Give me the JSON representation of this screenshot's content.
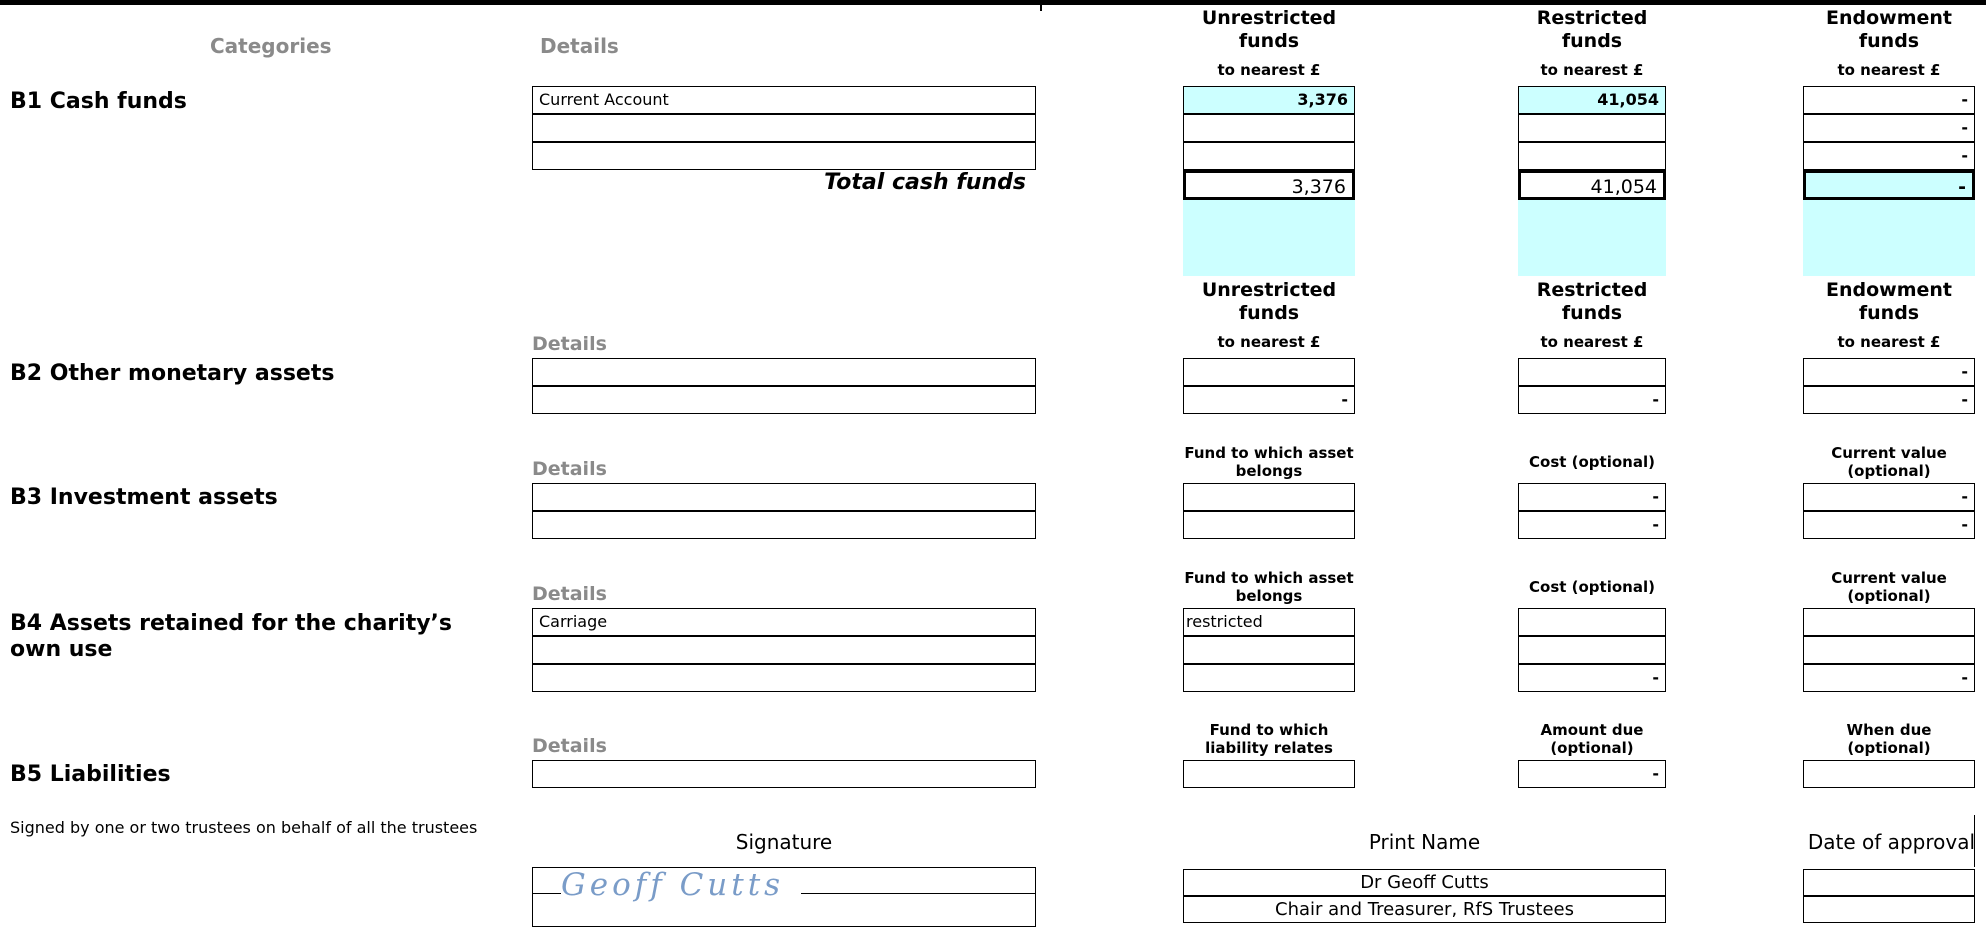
{
  "header": {
    "categories": "Categories",
    "details": "Details",
    "col_unrestricted": "Unrestricted funds",
    "col_restricted": "Restricted funds",
    "col_endowment": "Endowment funds",
    "nearest": "to nearest £"
  },
  "b1": {
    "title": "B1 Cash funds",
    "rows": [
      {
        "detail": "Current Account",
        "unrestricted": "3,376",
        "restricted": "41,054",
        "endowment": "-"
      },
      {
        "detail": "",
        "unrestricted": "",
        "restricted": "",
        "endowment": "-"
      },
      {
        "detail": "",
        "unrestricted": "",
        "restricted": "",
        "endowment": "-"
      }
    ],
    "total_label": "Total cash funds",
    "total_unrestricted": "3,376",
    "total_restricted": "41,054",
    "total_endowment": "-"
  },
  "b2": {
    "title": "B2 Other monetary assets",
    "details": "Details",
    "col_unrestricted": "Unrestricted funds",
    "col_restricted": "Restricted funds",
    "col_endowment": "Endowment funds",
    "nearest": "to nearest £",
    "rows": [
      {
        "unrestricted": "",
        "restricted": "",
        "endowment": "-"
      },
      {
        "unrestricted": "-",
        "restricted": "-",
        "endowment": "-"
      }
    ]
  },
  "b3": {
    "title": "B3 Investment assets",
    "details": "Details",
    "col_fund": "Fund to which asset belongs",
    "col_cost": "Cost (optional)",
    "col_current": "Current value (optional)",
    "rows": [
      {
        "cost": "-",
        "current": "-"
      },
      {
        "cost": "-",
        "current": "-"
      }
    ]
  },
  "b4": {
    "title": "B4 Assets retained for the charity’s own use",
    "details": "Details",
    "col_fund": "Fund to which asset belongs",
    "col_cost": "Cost (optional)",
    "col_current": "Current value (optional)",
    "rows": [
      {
        "detail": "Carriage",
        "fund": "restricted",
        "cost": "",
        "current": ""
      },
      {
        "detail": "",
        "fund": "",
        "cost": "",
        "current": ""
      },
      {
        "detail": "",
        "fund": "",
        "cost": "-",
        "current": "-"
      }
    ]
  },
  "b5": {
    "title": "B5 Liabilities",
    "details": "Details",
    "col_fund": "Fund to which liability relates",
    "col_amount": "Amount due (optional)",
    "col_when": "When due (optional)",
    "amount": "-"
  },
  "sign": {
    "note": "Signed by one or two trustees on behalf of all the trustees",
    "signature_label": "Signature",
    "print_label": "Print Name",
    "date_label": "Date of approval",
    "signature_text": "Geoff Cutts",
    "name": "Dr Geoff Cutts",
    "role": "Chair and Treasurer, RfS Trustees"
  },
  "colors": {
    "highlight": "#ccffff",
    "heading_grey": "#8a8a8a",
    "signature_ink": "#7a9cc8"
  }
}
